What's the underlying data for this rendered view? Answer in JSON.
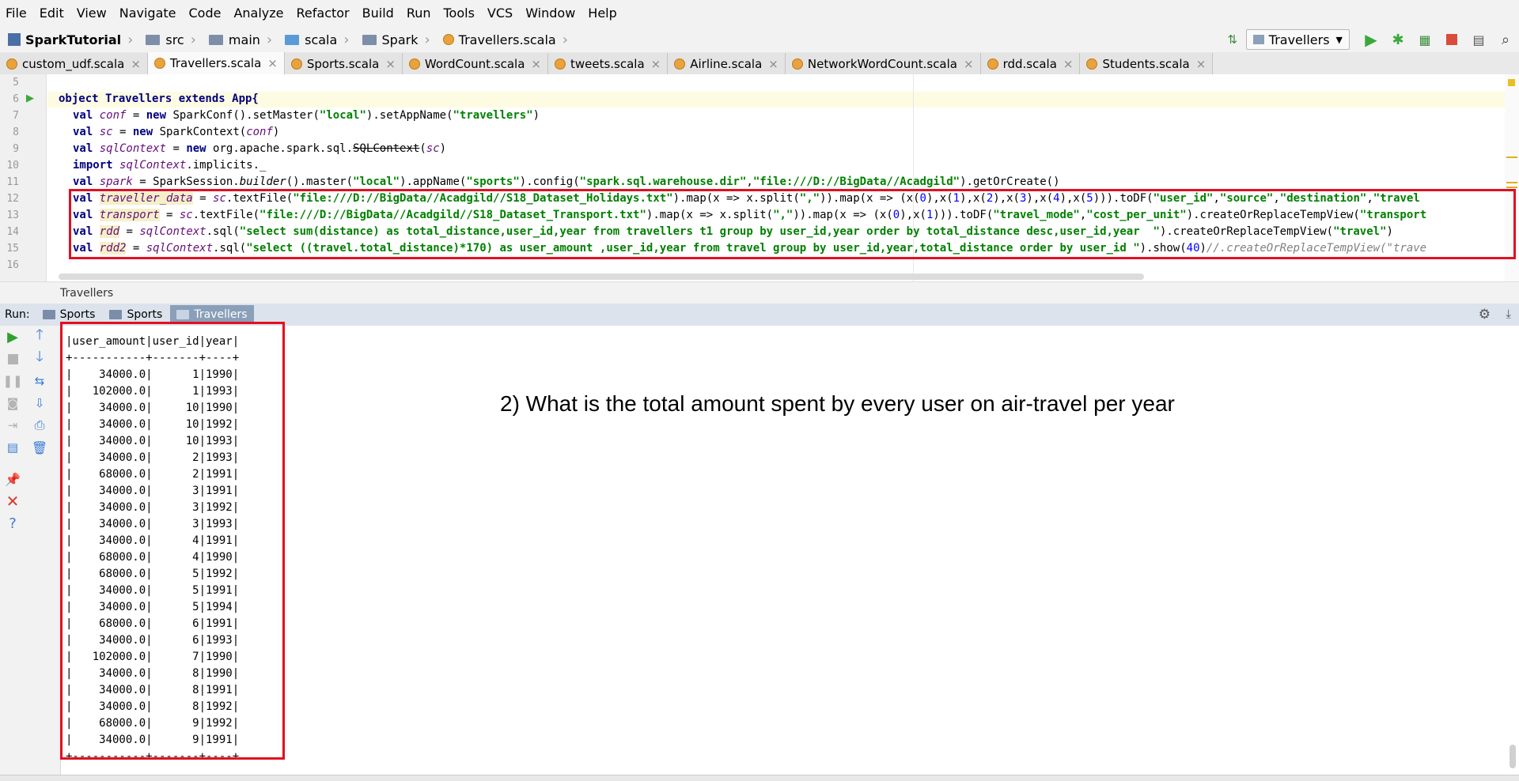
{
  "menu": [
    "File",
    "Edit",
    "View",
    "Navigate",
    "Code",
    "Analyze",
    "Refactor",
    "Build",
    "Run",
    "Tools",
    "VCS",
    "Window",
    "Help"
  ],
  "breadcrumb": {
    "project": "SparkTutorial",
    "folders": [
      "src",
      "main",
      "scala",
      "Spark"
    ],
    "file": "Travellers.scala"
  },
  "toolbar": {
    "run_config": "Travellers"
  },
  "tabs": [
    {
      "label": "custom_udf.scala",
      "active": false
    },
    {
      "label": "Travellers.scala",
      "active": true
    },
    {
      "label": "Sports.scala",
      "active": false
    },
    {
      "label": "WordCount.scala",
      "active": false
    },
    {
      "label": "tweets.scala",
      "active": false
    },
    {
      "label": "Airline.scala",
      "active": false
    },
    {
      "label": "NetworkWordCount.scala",
      "active": false
    },
    {
      "label": "rdd.scala",
      "active": false
    },
    {
      "label": "Students.scala",
      "active": false
    }
  ],
  "editor": {
    "line_numbers": [
      "5",
      "6",
      "7",
      "8",
      "9",
      "10",
      "11",
      "12",
      "13",
      "14",
      "15",
      "16"
    ],
    "code": {
      "l6": "object Travellers extends App{",
      "l7a": "val ",
      "l7b": "conf",
      "l7c": " = ",
      "l7d": "new",
      "l7e": " SparkConf().setMaster(",
      "l7f": "\"local\"",
      "l7g": ").setAppName(",
      "l7h": "\"travellers\"",
      "l7i": ")",
      "l8a": "val ",
      "l8b": "sc",
      "l8c": " = ",
      "l8d": "new",
      "l8e": " SparkContext(",
      "l8f": "conf",
      "l8g": ")",
      "l9a": "val ",
      "l9b": "sqlContext",
      "l9c": " = ",
      "l9d": "new",
      "l9e": " org.apache.spark.sql.",
      "l9f": "SQLContext",
      "l9g": "(",
      "l9h": "sc",
      "l9i": ")",
      "l10a": "import ",
      "l10b": "sqlContext",
      "l10c": ".implicits._",
      "l11a": "val ",
      "l11b": "spark",
      "l11c": " = SparkSession.",
      "l11d": "builder",
      "l11e": "().master(",
      "l11f": "\"local\"",
      "l11g": ").appName(",
      "l11h": "\"sports\"",
      "l11i": ").config(",
      "l11j": "\"spark.sql.warehouse.dir\"",
      "l11k": ",",
      "l11l": "\"file:///D://BigData//Acadgild\"",
      "l11m": ").getOrCreate()",
      "l12a": "val ",
      "l12b": "traveller_data",
      "l12c": " = ",
      "l12d": "sc",
      "l12e": ".textFile(",
      "l12f": "\"file:///D://BigData//Acadgild//S18_Dataset_Holidays.txt\"",
      "l12g": ").map(x => x.split(",
      "l12h": "\",\"",
      "l12i": ")).map(x => (x(",
      "l12j": "0",
      "l12k": "),x(",
      "l12l": "1",
      "l12m": "),x(",
      "l12n": "2",
      "l12o": "),x(",
      "l12p": "3",
      "l12q": "),x(",
      "l12r": "4",
      "l12s": "),x(",
      "l12t": "5",
      "l12u": "))).toDF(",
      "l12v": "\"user_id\"",
      "l12w": ",",
      "l12x": "\"source\"",
      "l12y": ",",
      "l12z": "\"destination\"",
      "l12aa": ",",
      "l12ab": "\"travel",
      "l13a": "val ",
      "l13b": "transport",
      "l13c": " = ",
      "l13d": "sc",
      "l13e": ".textFile(",
      "l13f": "\"file:///D://BigData//Acadgild//S18_Dataset_Transport.txt\"",
      "l13g": ").map(x => x.split(",
      "l13h": "\",\"",
      "l13i": ")).map(x => (x(",
      "l13j": "0",
      "l13k": "),x(",
      "l13l": "1",
      "l13m": "))).toDF(",
      "l13n": "\"travel_mode\"",
      "l13o": ",",
      "l13p": "\"cost_per_unit\"",
      "l13q": ").createOrReplaceTempView(",
      "l13r": "\"transport",
      "l14a": "val ",
      "l14b": "rdd",
      "l14c": " = ",
      "l14d": "sqlContext",
      "l14e": ".sql(",
      "l14f": "\"select sum(distance) as total_distance,user_id,year from travellers t1 group by user_id,year order by total_distance desc,user_id,year  \"",
      "l14g": ").createOrReplaceTempView(",
      "l14h": "\"travel\"",
      "l14i": ")",
      "l15a": "val ",
      "l15b": "rdd2",
      "l15c": " = ",
      "l15d": "sqlContext",
      "l15e": ".sql(",
      "l15f": "\"select ((travel.total_distance)*170) as user_amount ,user_id,year from travel group by user_id,year,total_distance order by user_id \"",
      "l15g": ").show(",
      "l15h": "40",
      "l15i": ")",
      "l15j": "//.createOrReplaceTempView(\"trave"
    },
    "file_breadcrumb": "Travellers"
  },
  "run_panel": {
    "label": "Run:",
    "tabs": [
      {
        "label": "Sports",
        "active": false
      },
      {
        "label": "Sports",
        "active": false
      },
      {
        "label": "Travellers",
        "active": true
      }
    ]
  },
  "output": {
    "header": "|user_amount|user_id|year|",
    "separator": "+-----------+-------+----+",
    "rows": [
      "|    34000.0|      1|1990|",
      "|   102000.0|      1|1993|",
      "|    34000.0|     10|1990|",
      "|    34000.0|     10|1992|",
      "|    34000.0|     10|1993|",
      "|    34000.0|      2|1993|",
      "|    68000.0|      2|1991|",
      "|    34000.0|      3|1991|",
      "|    34000.0|      3|1992|",
      "|    34000.0|      3|1993|",
      "|    34000.0|      4|1991|",
      "|    68000.0|      4|1990|",
      "|    68000.0|      5|1992|",
      "|    34000.0|      5|1991|",
      "|    34000.0|      5|1994|",
      "|    68000.0|      6|1991|",
      "|    34000.0|      6|1993|",
      "|   102000.0|      7|1990|",
      "|    34000.0|      8|1990|",
      "|    34000.0|      8|1991|",
      "|    34000.0|      8|1992|",
      "|    68000.0|      9|1992|",
      "|    34000.0|      9|1991|"
    ],
    "footer": "+-----------+-------+----+"
  },
  "annotation": "2) What is the total amount spent by every user on air-travel per year"
}
